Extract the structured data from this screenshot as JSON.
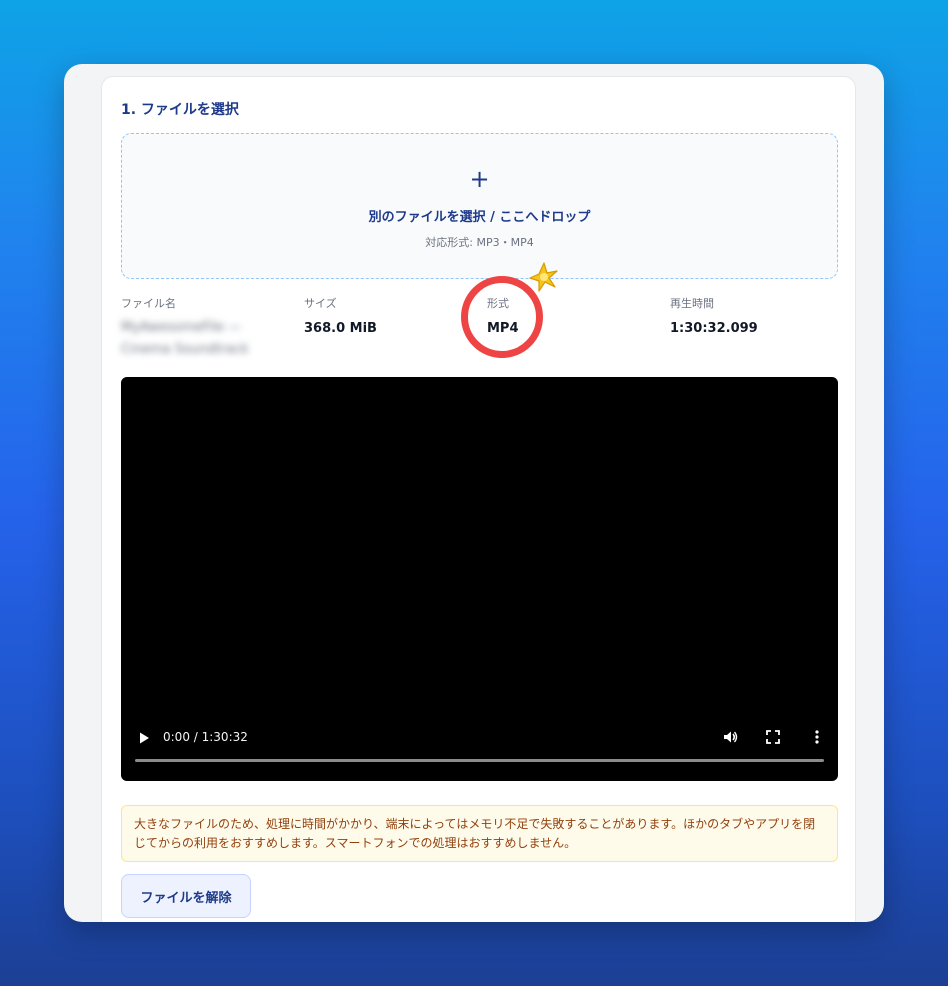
{
  "section": {
    "title": "1. ファイルを選択"
  },
  "dropzone": {
    "plus": "+",
    "label": "別のファイルを選択 / ここへドロップ",
    "formats": "対応形式: MP3・MP4"
  },
  "file_info": {
    "name_label": "ファイル名",
    "name_value": "MyAwesomeFile — Cinema Soundtrack",
    "size_label": "サイズ",
    "size_value": "368.0 MiB",
    "format_label": "形式",
    "format_value": "MP4",
    "duration_label": "再生時間",
    "duration_value": "1:30:32.099"
  },
  "player": {
    "time": "0:00 / 1:30:32",
    "progress": 0
  },
  "warning": {
    "text": "大きなファイルのため、処理に時間がかかり、端末によってはメモリ不足で失敗することがあります。ほかのタブやアプリを閉じてからの利用をおすすめします。スマートフォンでの処理はおすすめしません。"
  },
  "actions": {
    "clear_label": "ファイルを解除"
  },
  "colors": {
    "accent": "#1e3a8a",
    "highlight": "#ef4444",
    "warning_bg": "#fffbeb",
    "warning_text": "#92400e"
  },
  "icons": {
    "dropzone": "plus-icon",
    "play": "play-icon",
    "volume": "volume-icon",
    "fullscreen": "fullscreen-icon",
    "more": "more-options-icon",
    "sparkle": "sparkle-icon"
  }
}
